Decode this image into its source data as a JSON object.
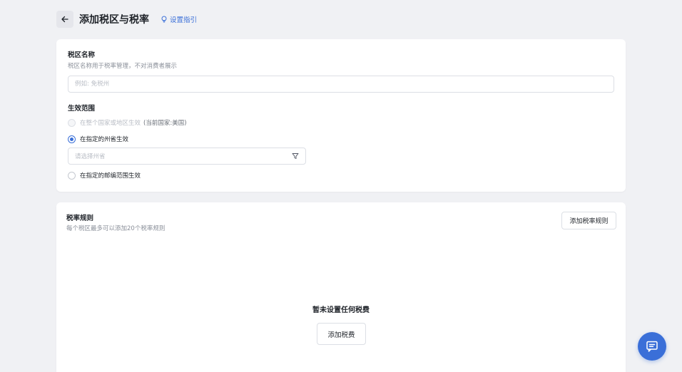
{
  "header": {
    "title": "添加税区与税率",
    "guide_link": "设置指引"
  },
  "zone": {
    "name_label": "税区名称",
    "name_hint": "税区名称用于税率管理，不对消费者展示",
    "name_placeholder": "例如: 免税州",
    "scope_label": "生效范围",
    "options": [
      {
        "label": "在整个国家或地区生效",
        "note": "(当前国家:美国)",
        "state": "disabled"
      },
      {
        "label": "在指定的州省生效",
        "state": "checked"
      },
      {
        "label": "在指定的邮编范围生效",
        "state": "unchecked"
      }
    ],
    "province_placeholder": "请选择州省"
  },
  "rules": {
    "title": "税率规则",
    "hint": "每个税区最多可以添加20个税率规则",
    "add_rule_button": "添加税率规则",
    "empty_title": "暂未设置任何税费",
    "add_tax_button": "添加税费"
  },
  "colors": {
    "accent": "#3a6fd8",
    "background": "#f0f1f4"
  }
}
